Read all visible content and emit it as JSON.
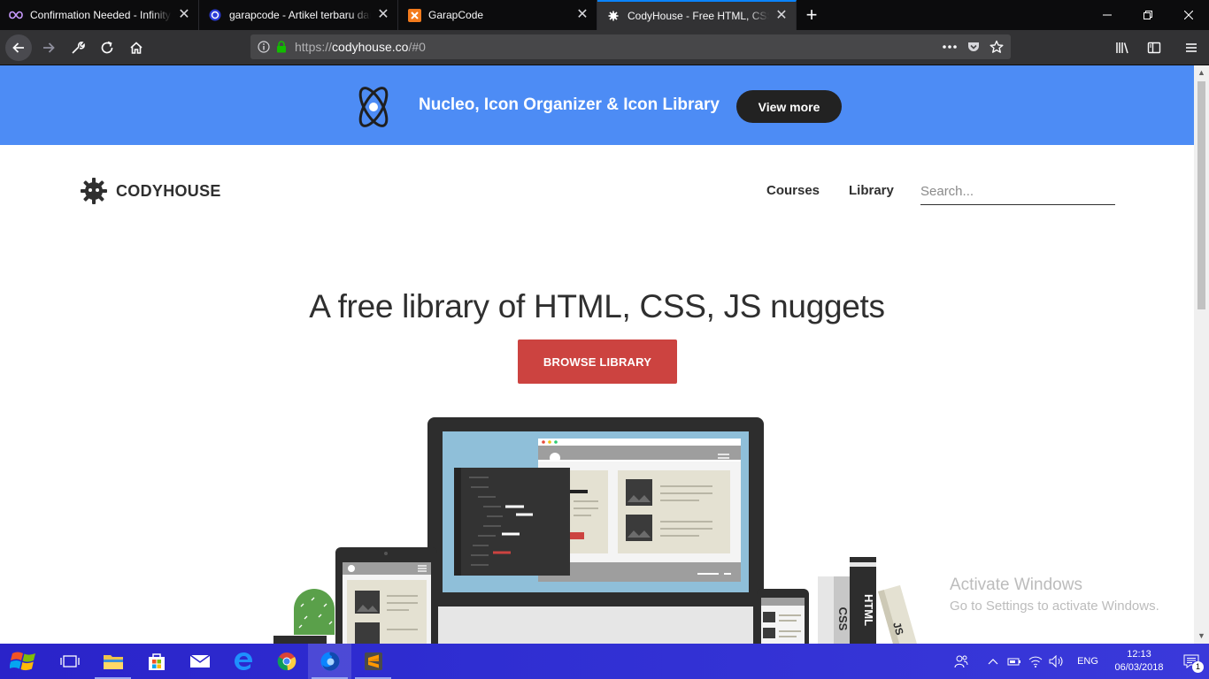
{
  "browser": {
    "tabs": [
      {
        "title": "Confirmation Needed - Infinity",
        "close": "✕",
        "active": false
      },
      {
        "title": "garapcode - Artikel terbaru dan",
        "close": "✕",
        "active": false
      },
      {
        "title": "GarapCode",
        "close": "✕",
        "active": false
      },
      {
        "title": "CodyHouse - Free HTML, CSS, J",
        "close": "✕",
        "active": true
      }
    ],
    "new_tab": "+",
    "url": {
      "scheme": "https://",
      "host": "codyhouse.co",
      "path": "/#0"
    }
  },
  "promo": {
    "text": "Nucleo, Icon Organizer & Icon Library",
    "button": "View more"
  },
  "header": {
    "logo": "CODYHOUSE",
    "nav": [
      "Courses",
      "Library"
    ],
    "search_placeholder": "Search..."
  },
  "hero": {
    "title": "A free library of HTML, CSS, JS nuggets",
    "button": "BROWSE LIBRARY"
  },
  "illustration": {
    "book_labels": [
      "CSS",
      "HTML",
      "JS"
    ]
  },
  "watermark": {
    "title": "Activate Windows",
    "subtitle": "Go to Settings to activate Windows."
  },
  "taskbar": {
    "language": "ENG",
    "time": "12:13",
    "date": "06/03/2018",
    "notifications": "1"
  },
  "colors": {
    "promo_bg": "#4d8cf5",
    "browse_button": "#cc4340",
    "tab_accent": "#0a84ff"
  }
}
